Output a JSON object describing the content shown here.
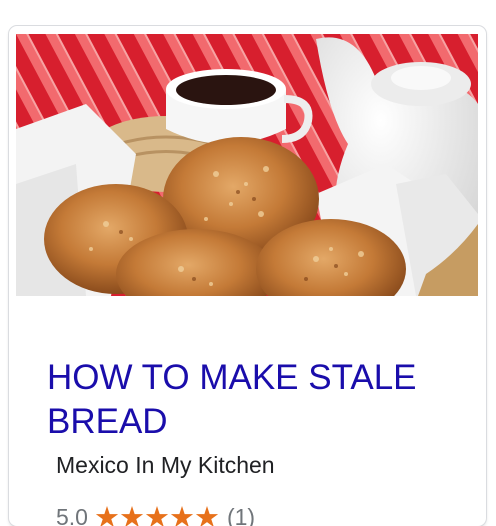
{
  "result_card": {
    "title": "HOW TO MAKE STALE BREAD",
    "source": "Mexico In My Kitchen",
    "rating": {
      "value_text": "5.0",
      "value": 5.0,
      "max": 5,
      "count_text": "(1)",
      "star_color": "#e7711b"
    },
    "title_color": "#1a0dab"
  }
}
